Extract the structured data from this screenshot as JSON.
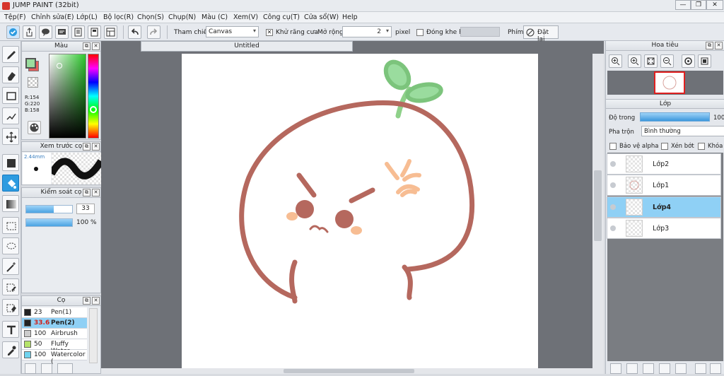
{
  "window": {
    "title": "JUMP PAINT (32bit)"
  },
  "menu": [
    "Tệp(F)",
    "Chỉnh sửa(E)",
    "Lớp(L)",
    "Bộ lọc(R)",
    "Chọn(S)",
    "Chụp(N)",
    "Màu (C)",
    "Xem(V)",
    "Công cụ(T)",
    "Cửa sổ(W)",
    "Help"
  ],
  "toolbar": {
    "reference_label": "Tham chiếu",
    "reference_value": "Canvas",
    "antialias_label": "Khử răng cưa",
    "expand_label": "Mở rộng",
    "expand_value": "2",
    "expand_unit": "pixel",
    "close_gap_label": "Đóng khe hở",
    "key_label": "Phím",
    "reset_label": "Đặt lại"
  },
  "color_panel": {
    "title": "Màu",
    "r": "R:154",
    "g": "G:220",
    "b": "B:158",
    "fg_color": "#9adc9e",
    "bg_color": "#e55d5d"
  },
  "brush_preview": {
    "title": "Xem trước cọ",
    "size": "2.44mm"
  },
  "brush_control": {
    "title": "Kiểm soát cọ",
    "size": "33",
    "opacity": "100 %"
  },
  "brush_list": {
    "title": "Cọ",
    "items": [
      {
        "size": "23",
        "name": "Pen(1)",
        "color": "#222222"
      },
      {
        "size": "33.6",
        "name": "Pen(2)",
        "color": "#222222"
      },
      {
        "size": "100",
        "name": "Airbrush",
        "color": "#cccccc"
      },
      {
        "size": "50",
        "name": "Fluffy Water",
        "color": "#b5e36a"
      },
      {
        "size": "100",
        "name": "Watercolor (",
        "color": "#6fd3ee"
      }
    ]
  },
  "document": {
    "tab_title": "Untitled"
  },
  "navigator": {
    "title": "Hoa tiêu"
  },
  "layers_panel": {
    "title": "Lớp",
    "opacity_label": "Độ trong",
    "opacity_value": "100",
    "blend_label": "Pha trộn",
    "blend_value": "Bình thường",
    "protect_alpha": "Bảo vệ alpha",
    "clipping": "Xén bớt",
    "lock": "Khóa",
    "layers": [
      "Lớp2",
      "Lớp1",
      "Lớp4",
      "Lớp3"
    ]
  },
  "drawing_colors": {
    "outline": "#b5685e",
    "blush": "#f7bd93",
    "sprout": "#8fd18a",
    "anger": "#f7bd93"
  }
}
